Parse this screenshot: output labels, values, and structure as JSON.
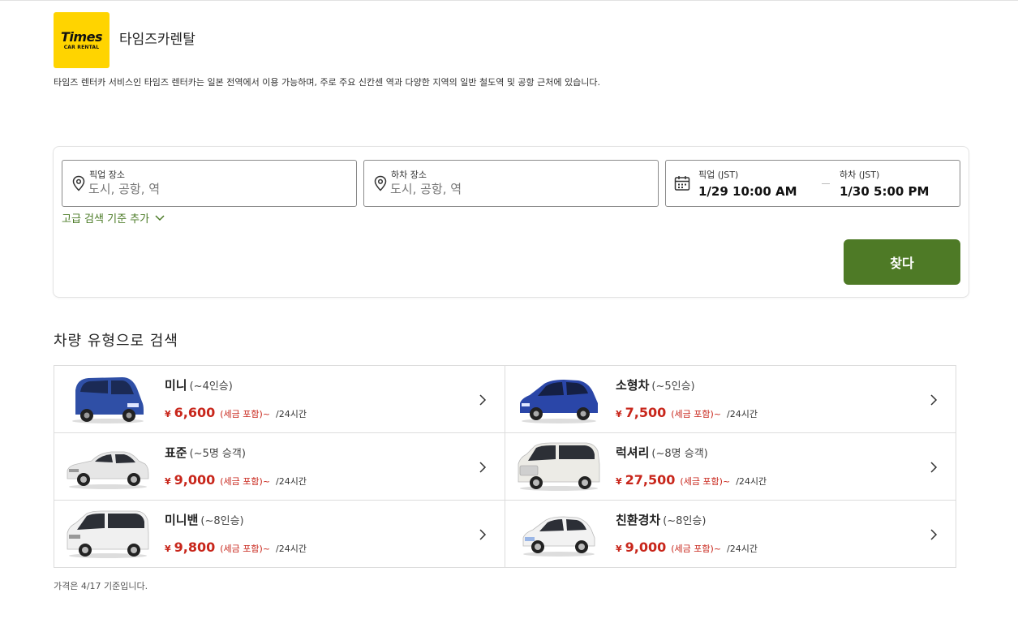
{
  "brand": {
    "logo_word": "Times",
    "logo_sub": "CAR RENTAL",
    "logo_color": "#ffd400",
    "title": "타임즈카렌탈",
    "description": "타임즈 렌터카 서비스인 타임즈 렌터카는 일본 전역에서 이용 가능하며, 주로 주요 신칸센 역과 다양한 지역의 일반 철도역 및 공항 근처에 있습니다."
  },
  "search": {
    "pickup_label": "픽업 장소",
    "pickup_placeholder": "도시, 공항, 역",
    "dropoff_label": "하차 장소",
    "dropoff_placeholder": "도시, 공항, 역",
    "pickup_date_label": "픽업 (JST)",
    "pickup_date_value": "1/29 10:00 AM",
    "dropoff_date_label": "하차 (JST)",
    "dropoff_date_value": "1/30 5:00 PM",
    "advanced_label": "고급 검색 기준 추가",
    "button_label": "찾다",
    "button_color": "#4e7a26",
    "icons": [
      "location-pin-icon",
      "calendar-icon",
      "chevron-down-icon"
    ]
  },
  "section": {
    "title": "차량 유형으로 검색"
  },
  "vehicles": [
    {
      "name": "미니",
      "capacity": "(~4인승)",
      "currency": "¥",
      "price": "6,600",
      "tax": "(세금 포함)~",
      "per": "/24시간",
      "car_color": "#2f4fa6"
    },
    {
      "name": "소형차",
      "capacity": "(~5인승)",
      "currency": "¥",
      "price": "7,500",
      "tax": "(세금 포함)~",
      "per": "/24시간",
      "car_color": "#2a46a8"
    },
    {
      "name": "표준",
      "capacity": "(~5명 승객)",
      "currency": "¥",
      "price": "9,000",
      "tax": "(세금 포함)~",
      "per": "/24시간",
      "car_color": "#e6e6e6"
    },
    {
      "name": "럭셔리",
      "capacity": "(~8명 승객)",
      "currency": "¥",
      "price": "27,500",
      "tax": "(세금 포함)~",
      "per": "/24시간",
      "car_color": "#ecebe6"
    },
    {
      "name": "미니밴",
      "capacity": "(~8인승)",
      "currency": "¥",
      "price": "9,800",
      "tax": "(세금 포함)~",
      "per": "/24시간",
      "car_color": "#f0f0f0"
    },
    {
      "name": "친환경차",
      "capacity": "(~8인승)",
      "currency": "¥",
      "price": "9,000",
      "tax": "(세금 포함)~",
      "per": "/24시간",
      "car_color": "#f2f2f2"
    }
  ],
  "footnote": "가격은 4/17 기준입니다.",
  "colors": {
    "price_red": "#c8261b",
    "link_green": "#4a7a25"
  }
}
